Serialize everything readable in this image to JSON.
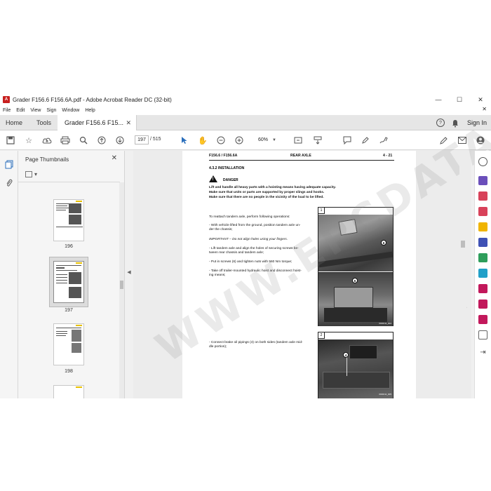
{
  "window": {
    "title": "Grader F156.6 F156.6A.pdf - Adobe Acrobat Reader DC (32-bit)",
    "minimize": "—",
    "maximize": "☐",
    "close": "✕"
  },
  "menu": [
    "File",
    "Edit",
    "View",
    "Sign",
    "Window",
    "Help"
  ],
  "tabs": {
    "home": "Home",
    "tools": "Tools",
    "doc": "Grader F156.6 F15...",
    "doc_close": "✕"
  },
  "account": {
    "sign_in": "Sign In"
  },
  "toolbar": {
    "page_current": "197",
    "page_total": "/ 515",
    "zoom": "60%"
  },
  "thumbnails": {
    "title": "Page Thumbnails",
    "pages": [
      "196",
      "197",
      "198"
    ],
    "selected": "197"
  },
  "page": {
    "header_left": "F156.6 / F156.6A",
    "header_center": "REAR AXLE",
    "header_right": "4 - 21",
    "section": "4.3.2   INSTALLATION",
    "danger_label": "DANGER",
    "danger_lines": [
      "Lift and handle all heavy parts with a hoisting means having adequate capacity.",
      "Make sure that units or parts are supported by proper slings and hooks.",
      "Make sure that there are no people in the vicinity of the load to be lifted."
    ],
    "intro": "To reattach tandem axle, perform following operations:",
    "step1": [
      "-   With vehicle lifted from the ground, position tandem axle un-",
      "    der the chassis;"
    ],
    "important": "IMPORTANT – Do not align holes using your fingers.",
    "step2": [
      "-   Lift tandem axle and align the holes of securing screws be-",
      "    tween rear chassis and tandem axle;"
    ],
    "step3": "-   Put in screws (6) and tighten nuts with 560 Nm torque;",
    "step4": [
      "-   Take off trailer-mounted hydraulic hoist and disconnect hoist-",
      "    ing means;"
    ],
    "step5": [
      "-   Connect brake oil pipings (4) on both sides (tandem axle mid-",
      "    dle portion);"
    ],
    "fig1": "1",
    "fig2": "2",
    "callout6": "6",
    "callout4": "4",
    "photo_code1": "09DO11_004",
    "photo_code2": "09DO11_005"
  },
  "watermark": "WWW.EPCDATA.COM"
}
